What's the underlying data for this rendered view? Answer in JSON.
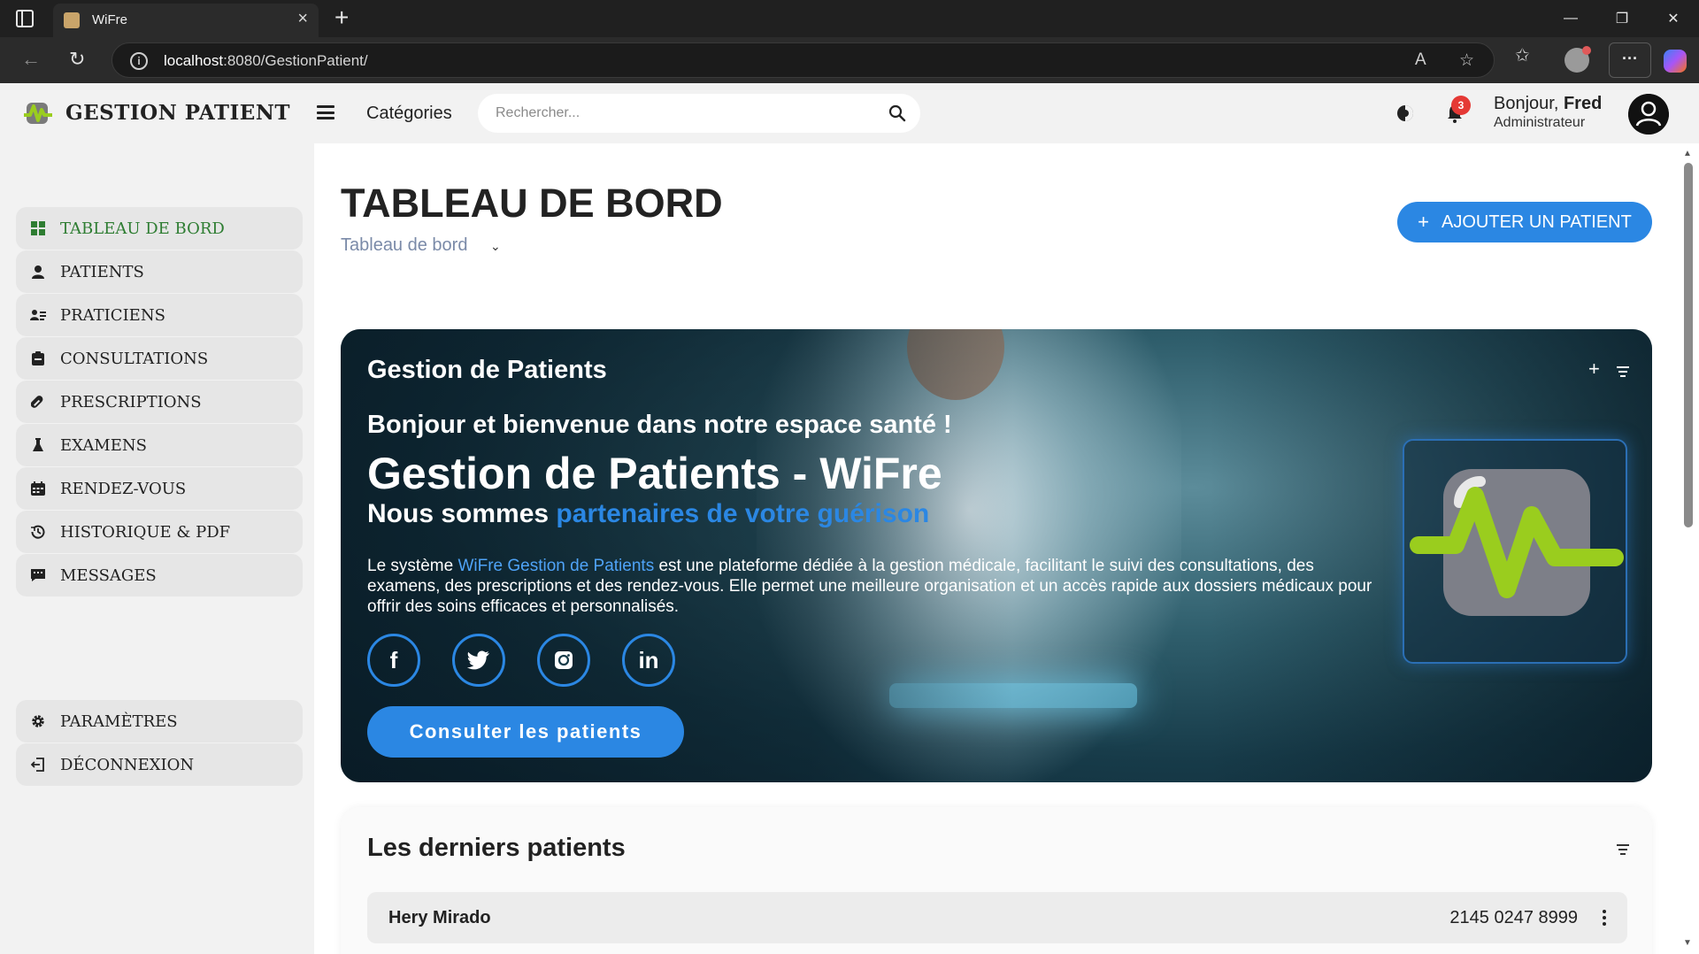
{
  "browser": {
    "tab_title": "WiFre",
    "url_host": "localhost",
    "url_rest": ":8080/GestionPatient/"
  },
  "header": {
    "brand": "GESTION PATIENT",
    "categories": "Catégories",
    "search_placeholder": "Rechercher...",
    "notification_count": "3",
    "greeting": "Bonjour,",
    "user_name": "Fred",
    "user_role": "Administrateur"
  },
  "sidebar": {
    "items": [
      {
        "label": "TABLEAU DE BORD",
        "icon": "grid-icon"
      },
      {
        "label": "PATIENTS",
        "icon": "user-icon"
      },
      {
        "label": "PRATICIENS",
        "icon": "id-card-icon"
      },
      {
        "label": "CONSULTATIONS",
        "icon": "clipboard-icon"
      },
      {
        "label": "PRESCRIPTIONS",
        "icon": "pill-icon"
      },
      {
        "label": "EXAMENS",
        "icon": "flask-icon"
      },
      {
        "label": "RENDEZ-VOUS",
        "icon": "calendar-icon"
      },
      {
        "label": "HISTORIQUE & PDF",
        "icon": "history-icon"
      },
      {
        "label": "MESSAGES",
        "icon": "message-icon"
      }
    ],
    "bottom": [
      {
        "label": "PARAMÈTRES",
        "icon": "gear-icon"
      },
      {
        "label": "DÉCONNEXION",
        "icon": "logout-icon"
      }
    ]
  },
  "main": {
    "title": "TABLEAU DE BORD",
    "breadcrumb": "Tableau de bord",
    "add_button": "AJOUTER UN PATIENT"
  },
  "hero": {
    "title": "Gestion de Patients",
    "welcome": "Bonjour et bienvenue dans notre espace santé !",
    "big_title": "Gestion de Patients - WiFre",
    "tagline_prefix": "Nous sommes",
    "tagline_highlight": "partenaires de votre guérison",
    "desc_prefix": "Le système",
    "desc_highlight": "WiFre Gestion de Patients",
    "desc_rest": "est une plateforme dédiée à la gestion médicale, facilitant le suivi des consultations, des examens, des prescriptions et des rendez-vous. Elle permet une meilleure organisation et un accès rapide aux dossiers médicaux pour offrir des soins efficaces et personnalisés.",
    "socials": [
      {
        "name": "facebook-icon",
        "glyph": "f"
      },
      {
        "name": "twitter-icon",
        "glyph": "🐦"
      },
      {
        "name": "instagram-icon",
        "glyph": "◎"
      },
      {
        "name": "linkedin-icon",
        "glyph": "in"
      }
    ],
    "cta": "Consulter les patients"
  },
  "patients": {
    "title": "Les derniers patients",
    "rows": [
      {
        "name": "Hery Mirado",
        "phone": "2145 0247 8999"
      }
    ]
  },
  "colors": {
    "accent": "#2b87e3",
    "active_nav": "#2e7d32",
    "badge": "#e53935",
    "logo_green": "#9acd1e"
  }
}
